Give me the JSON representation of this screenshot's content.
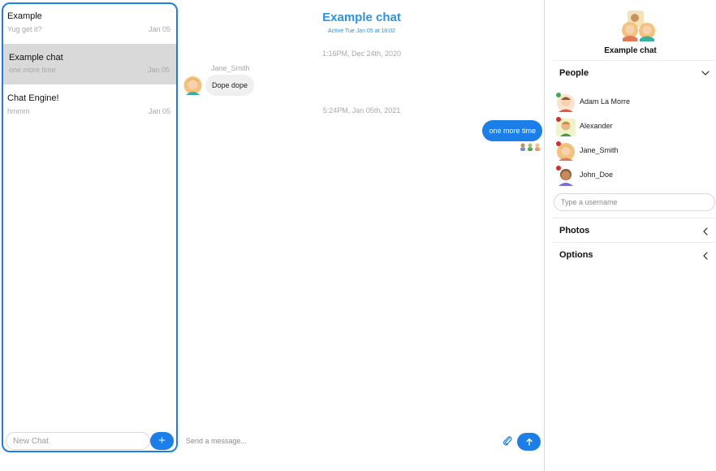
{
  "chat_list": [
    {
      "title": "Example",
      "preview": "Yug get it?",
      "date": "Jan 05",
      "active": false
    },
    {
      "title": "Example chat",
      "preview": "one more time",
      "date": "Jan 05",
      "active": true
    },
    {
      "title": "Chat Engine!",
      "preview": "hmmm",
      "date": "Jan 05",
      "active": false
    }
  ],
  "new_chat": {
    "placeholder": "New Chat",
    "add_label": "+"
  },
  "chat": {
    "title": "Example chat",
    "subtitle": "Active Tue Jan 05 at 18:02",
    "timestamps": [
      "1:16PM, Dec 24th, 2020",
      "5:24PM, Jan 05th, 2021"
    ],
    "incoming": {
      "sender": "Jane_Smith",
      "text": "Dope dope"
    },
    "outgoing": {
      "text": "one more time"
    },
    "input_placeholder": "Send a message..."
  },
  "settings": {
    "group_title": "Example chat",
    "people_label": "People",
    "people": [
      {
        "name": "Adam La Morre",
        "online": true
      },
      {
        "name": "Alexander",
        "online": false
      },
      {
        "name": "Jane_Smith",
        "online": false
      },
      {
        "name": "John_Doe",
        "online": false
      }
    ],
    "username_placeholder": "Type a username",
    "photos_label": "Photos",
    "options_label": "Options"
  },
  "colors": {
    "accent": "#1c7ee8",
    "title_blue": "#2a93e8",
    "active_row": "#d9d9d9",
    "online": "#3cb14a",
    "offline": "#e02828"
  },
  "icons": [
    "add-icon",
    "paperclip-icon",
    "send-arrow-icon",
    "chevron-down-icon",
    "chevron-left-icon"
  ]
}
